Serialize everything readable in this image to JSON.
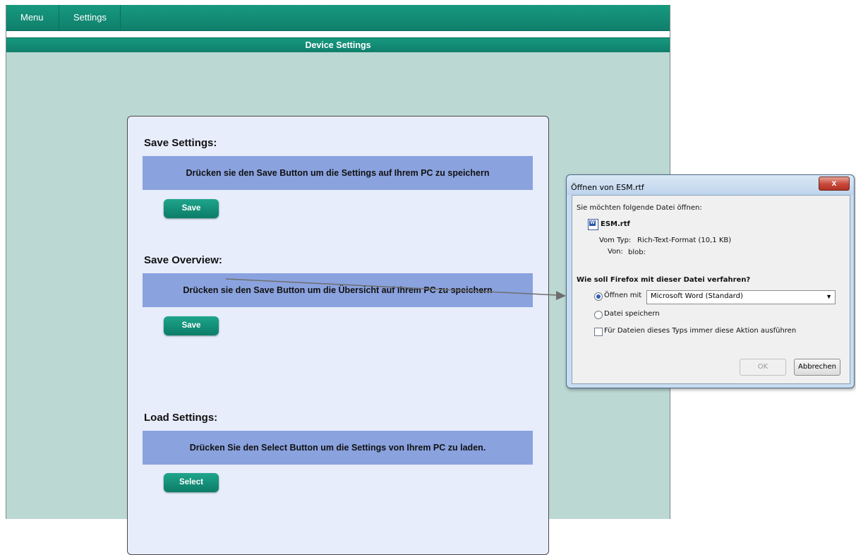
{
  "menu": {
    "items": [
      "Menu",
      "Settings"
    ]
  },
  "panel": {
    "title": "Device Settings"
  },
  "sections": [
    {
      "title": "Save Settings:",
      "info": "Drücken sie den Save Button um die Settings auf Ihrem PC zu speichern",
      "button": "Save"
    },
    {
      "title": "Save Overview:",
      "info": "Drücken sie den Save Button um die Übersicht auf Ihrem PC zu speichern",
      "button": "Save"
    },
    {
      "title": "Load Settings:",
      "info": "Drücken Sie den Select Button um die Settings von Ihrem PC zu laden.",
      "button": "Select"
    }
  ],
  "dialog": {
    "title": "Öffnen von ESM.rtf",
    "close": "x",
    "prompt": "Sie möchten folgende Datei öffnen:",
    "filename": "ESM.rtf",
    "type_label": "Vom Typ:",
    "type_value": "Rich-Text-Format (10,1 KB)",
    "from_label": "Von:",
    "from_value": "blob:",
    "question": "Wie soll Firefox mit dieser Datei verfahren?",
    "open_with_label": "Öffnen mit",
    "open_with_value": "Microsoft Word (Standard)",
    "save_file_label": "Datei speichern",
    "always_label": "Für Dateien dieses Typs immer diese Aktion ausführen",
    "ok": "OK",
    "cancel": "Abbrechen"
  }
}
